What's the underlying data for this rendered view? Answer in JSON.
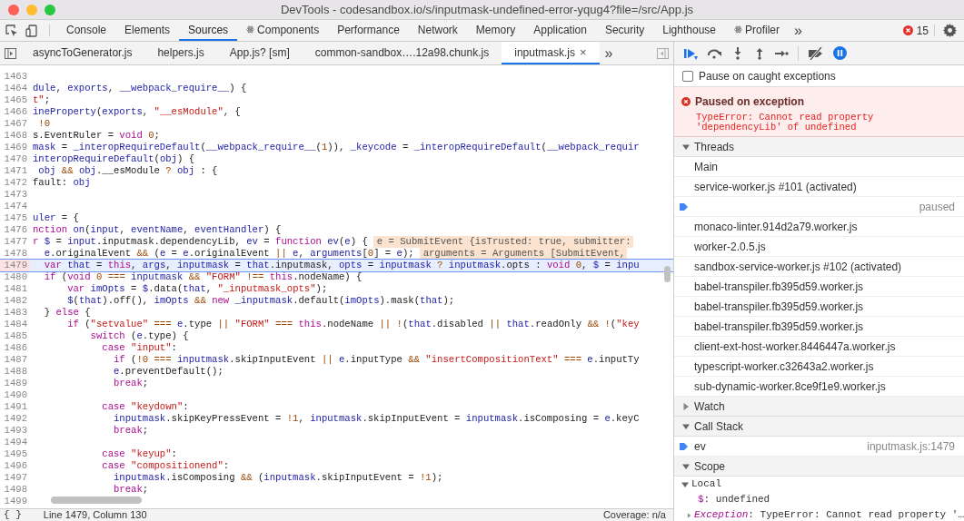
{
  "window": {
    "title": "DevTools - codesandbox.io/s/inputmask-undefined-error-yqug4?file=/src/App.js"
  },
  "panel_tabs": [
    {
      "label": "Console",
      "selected": false,
      "react": false
    },
    {
      "label": "Elements",
      "selected": false,
      "react": false
    },
    {
      "label": "Sources",
      "selected": true,
      "react": false
    },
    {
      "label": "Components",
      "selected": false,
      "react": true
    },
    {
      "label": "Performance",
      "selected": false,
      "react": false
    },
    {
      "label": "Network",
      "selected": false,
      "react": false
    },
    {
      "label": "Memory",
      "selected": false,
      "react": false
    },
    {
      "label": "Application",
      "selected": false,
      "react": false
    },
    {
      "label": "Security",
      "selected": false,
      "react": false
    },
    {
      "label": "Lighthouse",
      "selected": false,
      "react": false
    },
    {
      "label": "Profiler",
      "selected": false,
      "react": true
    }
  ],
  "more_tabs": "»",
  "error_count": "15",
  "file_tabs": [
    {
      "label": "asyncToGenerator.js",
      "selected": false
    },
    {
      "label": "helpers.js",
      "selected": false
    },
    {
      "label": "App.js? [sm]",
      "selected": false
    },
    {
      "label": "common-sandbox….12a98.chunk.js",
      "selected": false
    },
    {
      "label": "inputmask.js",
      "selected": true,
      "close": "×"
    }
  ],
  "more_files": "»",
  "editor": {
    "lines": [
      {
        "number": "1463"
      },
      {
        "number": "1464",
        "tokens": [
          {
            "kind": "name",
            "text": "dule"
          },
          {
            "kind": "plain",
            "text": ", "
          },
          {
            "kind": "name",
            "text": "exports"
          },
          {
            "kind": "plain",
            "text": ", "
          },
          {
            "kind": "name",
            "text": "__webpack_require__"
          },
          {
            "kind": "plain",
            "text": ") {"
          }
        ]
      },
      {
        "number": "1465",
        "tokens": [
          {
            "kind": "string",
            "text": "t\""
          },
          {
            "kind": "plain",
            "text": ";"
          }
        ]
      },
      {
        "number": "1466",
        "tokens": [
          {
            "kind": "name",
            "text": "ineProperty"
          },
          {
            "kind": "plain",
            "text": "("
          },
          {
            "kind": "name",
            "text": "exports"
          },
          {
            "kind": "plain",
            "text": ", "
          },
          {
            "kind": "string",
            "text": "\"__esModule\""
          },
          {
            "kind": "plain",
            "text": ", {"
          }
        ]
      },
      {
        "number": "1467",
        "tokens": [
          {
            "kind": "operator",
            "text": " !0"
          }
        ]
      },
      {
        "number": "1468",
        "tokens": [
          {
            "kind": "plain",
            "text": "s.EventRuler = "
          },
          {
            "kind": "keyword",
            "text": "void "
          },
          {
            "kind": "operator",
            "text": "0"
          },
          {
            "kind": "plain",
            "text": ";"
          }
        ]
      },
      {
        "number": "1469",
        "tokens": [
          {
            "kind": "name",
            "text": "mask"
          },
          {
            "kind": "plain",
            "text": " = "
          },
          {
            "kind": "name",
            "text": "_interopRequireDefault"
          },
          {
            "kind": "plain",
            "text": "("
          },
          {
            "kind": "name",
            "text": "__webpack_require__"
          },
          {
            "kind": "plain",
            "text": "("
          },
          {
            "kind": "operator",
            "text": "1"
          },
          {
            "kind": "plain",
            "text": ")), "
          },
          {
            "kind": "name",
            "text": "_keycode"
          },
          {
            "kind": "plain",
            "text": " = "
          },
          {
            "kind": "name",
            "text": "_interopRequireDefault"
          },
          {
            "kind": "plain",
            "text": "("
          },
          {
            "kind": "name",
            "text": "__webpack_requir"
          }
        ]
      },
      {
        "number": "1470",
        "tokens": [
          {
            "kind": "name",
            "text": "interopRequireDefault"
          },
          {
            "kind": "plain",
            "text": "("
          },
          {
            "kind": "name",
            "text": "obj"
          },
          {
            "kind": "plain",
            "text": ") {"
          }
        ]
      },
      {
        "number": "1471",
        "tokens": [
          {
            "kind": "name",
            "text": " obj "
          },
          {
            "kind": "operator",
            "text": "&& "
          },
          {
            "kind": "name",
            "text": "obj"
          },
          {
            "kind": "plain",
            "text": ".__esModule "
          },
          {
            "kind": "operator",
            "text": "? "
          },
          {
            "kind": "name",
            "text": "obj"
          },
          {
            "kind": "plain",
            "text": " : {"
          }
        ]
      },
      {
        "number": "1472",
        "tokens": [
          {
            "kind": "plain",
            "text": "fault: "
          },
          {
            "kind": "name",
            "text": "obj"
          }
        ]
      },
      {
        "number": "1473"
      },
      {
        "number": "1474"
      },
      {
        "number": "1475",
        "tokens": [
          {
            "kind": "name",
            "text": "uler"
          },
          {
            "kind": "plain",
            "text": " = {"
          }
        ]
      },
      {
        "number": "1476",
        "tokens": [
          {
            "kind": "keyword",
            "text": "nction "
          },
          {
            "kind": "name",
            "text": "on"
          },
          {
            "kind": "plain",
            "text": "("
          },
          {
            "kind": "name",
            "text": "input"
          },
          {
            "kind": "plain",
            "text": ", "
          },
          {
            "kind": "name",
            "text": "eventName"
          },
          {
            "kind": "plain",
            "text": ", "
          },
          {
            "kind": "name",
            "text": "eventHandler"
          },
          {
            "kind": "plain",
            "text": ") {"
          }
        ]
      },
      {
        "number": "1477",
        "tokens": [
          {
            "kind": "keyword",
            "text": "r "
          },
          {
            "kind": "name",
            "text": "$"
          },
          {
            "kind": "plain",
            "text": " = "
          },
          {
            "kind": "name",
            "text": "input"
          },
          {
            "kind": "plain",
            "text": ".inputmask.dependencyLib, "
          },
          {
            "kind": "name",
            "text": "ev"
          },
          {
            "kind": "plain",
            "text": " = "
          },
          {
            "kind": "keyword",
            "text": "function "
          },
          {
            "kind": "name",
            "text": "ev"
          },
          {
            "kind": "plain",
            "text": "("
          },
          {
            "kind": "name",
            "text": "e"
          },
          {
            "kind": "plain",
            "text": ") {"
          }
        ],
        "inline_value": "e = SubmitEvent {isTrusted: true, submitter:"
      },
      {
        "number": "1478",
        "tokens": [
          {
            "kind": "name",
            "text": "  e"
          },
          {
            "kind": "plain",
            "text": ".originalEvent "
          },
          {
            "kind": "operator",
            "text": "&&"
          },
          {
            "kind": "plain",
            "text": " ("
          },
          {
            "kind": "name",
            "text": "e"
          },
          {
            "kind": "plain",
            "text": " = "
          },
          {
            "kind": "name",
            "text": "e"
          },
          {
            "kind": "plain",
            "text": ".originalEvent "
          },
          {
            "kind": "operator",
            "text": "||"
          },
          {
            "kind": "name",
            "text": " e"
          },
          {
            "kind": "plain",
            "text": ", "
          },
          {
            "kind": "name",
            "text": "arguments"
          },
          {
            "kind": "plain",
            "text": "["
          },
          {
            "kind": "operator",
            "text": "0"
          },
          {
            "kind": "plain",
            "text": "] = "
          },
          {
            "kind": "name",
            "text": "e"
          },
          {
            "kind": "plain",
            "text": ");"
          }
        ],
        "inline_value": "arguments = Arguments [SubmitEvent,"
      },
      {
        "number": "1479",
        "current": true,
        "tokens": [
          {
            "kind": "keyword",
            "text": "  var "
          },
          {
            "kind": "name",
            "text": "that"
          },
          {
            "kind": "plain",
            "text": " = "
          },
          {
            "kind": "keyword",
            "text": "this"
          },
          {
            "kind": "plain",
            "text": ", "
          },
          {
            "kind": "name",
            "text": "args"
          },
          {
            "kind": "plain",
            "text": ", "
          },
          {
            "kind": "name",
            "text": "inputmask"
          },
          {
            "kind": "plain",
            "text": " = "
          },
          {
            "kind": "name",
            "text": "that"
          },
          {
            "kind": "plain",
            "text": ".inputmask, "
          },
          {
            "kind": "name",
            "text": "opts"
          },
          {
            "kind": "plain",
            "text": " = "
          },
          {
            "kind": "name",
            "text": "inputmask "
          },
          {
            "kind": "operator",
            "text": "? "
          },
          {
            "kind": "name",
            "text": "inputmask"
          },
          {
            "kind": "plain",
            "text": ".opts : "
          },
          {
            "kind": "keyword",
            "text": "void "
          },
          {
            "kind": "operator",
            "text": "0"
          },
          {
            "kind": "plain",
            "text": ", "
          },
          {
            "kind": "name",
            "text": "$"
          },
          {
            "kind": "plain",
            "text": " = "
          },
          {
            "kind": "name",
            "text": "inpu"
          }
        ]
      },
      {
        "number": "1480",
        "tokens": [
          {
            "kind": "keyword",
            "text": "  if"
          },
          {
            "kind": "plain",
            "text": " ("
          },
          {
            "kind": "keyword",
            "text": "void "
          },
          {
            "kind": "operator",
            "text": "0 === "
          },
          {
            "kind": "name",
            "text": "inputmask "
          },
          {
            "kind": "operator",
            "text": "&& "
          },
          {
            "kind": "string",
            "text": "\"FORM\" "
          },
          {
            "kind": "operator",
            "text": "!== "
          },
          {
            "kind": "keyword",
            "text": "this"
          },
          {
            "kind": "plain",
            "text": ".nodeName) {"
          }
        ]
      },
      {
        "number": "1481",
        "tokens": [
          {
            "kind": "keyword",
            "text": "      var "
          },
          {
            "kind": "name",
            "text": "imOpts"
          },
          {
            "kind": "plain",
            "text": " = "
          },
          {
            "kind": "name",
            "text": "$"
          },
          {
            "kind": "plain",
            "text": ".data("
          },
          {
            "kind": "name",
            "text": "that"
          },
          {
            "kind": "plain",
            "text": ", "
          },
          {
            "kind": "string",
            "text": "\"_inputmask_opts\""
          },
          {
            "kind": "plain",
            "text": ");"
          }
        ]
      },
      {
        "number": "1482",
        "tokens": [
          {
            "kind": "name",
            "text": "      $"
          },
          {
            "kind": "plain",
            "text": "("
          },
          {
            "kind": "name",
            "text": "that"
          },
          {
            "kind": "plain",
            "text": ").off(), "
          },
          {
            "kind": "name",
            "text": "imOpts "
          },
          {
            "kind": "operator",
            "text": "&& "
          },
          {
            "kind": "keyword",
            "text": "new "
          },
          {
            "kind": "name",
            "text": "_inputmask"
          },
          {
            "kind": "plain",
            "text": ".default("
          },
          {
            "kind": "name",
            "text": "imOpts"
          },
          {
            "kind": "plain",
            "text": ").mask("
          },
          {
            "kind": "name",
            "text": "that"
          },
          {
            "kind": "plain",
            "text": ");"
          }
        ]
      },
      {
        "number": "1483",
        "tokens": [
          {
            "kind": "plain",
            "text": "  } "
          },
          {
            "kind": "keyword",
            "text": "else"
          },
          {
            "kind": "plain",
            "text": " {"
          }
        ]
      },
      {
        "number": "1484",
        "tokens": [
          {
            "kind": "keyword",
            "text": "      if"
          },
          {
            "kind": "plain",
            "text": " ("
          },
          {
            "kind": "string",
            "text": "\"setvalue\" "
          },
          {
            "kind": "operator",
            "text": "=== "
          },
          {
            "kind": "name",
            "text": "e"
          },
          {
            "kind": "plain",
            "text": ".type "
          },
          {
            "kind": "operator",
            "text": "|| "
          },
          {
            "kind": "string",
            "text": "\"FORM\" "
          },
          {
            "kind": "operator",
            "text": "=== "
          },
          {
            "kind": "keyword",
            "text": "this"
          },
          {
            "kind": "plain",
            "text": ".nodeName "
          },
          {
            "kind": "operator",
            "text": "|| !"
          },
          {
            "kind": "plain",
            "text": "("
          },
          {
            "kind": "name",
            "text": "that"
          },
          {
            "kind": "plain",
            "text": ".disabled "
          },
          {
            "kind": "operator",
            "text": "|| "
          },
          {
            "kind": "name",
            "text": "that"
          },
          {
            "kind": "plain",
            "text": ".readOnly "
          },
          {
            "kind": "operator",
            "text": "&& !"
          },
          {
            "kind": "plain",
            "text": "("
          },
          {
            "kind": "string",
            "text": "\"key"
          }
        ]
      },
      {
        "number": "1485",
        "tokens": [
          {
            "kind": "keyword",
            "text": "          switch"
          },
          {
            "kind": "plain",
            "text": " ("
          },
          {
            "kind": "name",
            "text": "e"
          },
          {
            "kind": "plain",
            "text": ".type) {"
          }
        ]
      },
      {
        "number": "1486",
        "tokens": [
          {
            "kind": "keyword",
            "text": "            case "
          },
          {
            "kind": "string",
            "text": "\"input\""
          },
          {
            "kind": "plain",
            "text": ":"
          }
        ]
      },
      {
        "number": "1487",
        "tokens": [
          {
            "kind": "keyword",
            "text": "              if"
          },
          {
            "kind": "plain",
            "text": " ("
          },
          {
            "kind": "operator",
            "text": "!0 === "
          },
          {
            "kind": "name",
            "text": "inputmask"
          },
          {
            "kind": "plain",
            "text": ".skipInputEvent "
          },
          {
            "kind": "operator",
            "text": "|| "
          },
          {
            "kind": "name",
            "text": "e"
          },
          {
            "kind": "plain",
            "text": ".inputType "
          },
          {
            "kind": "operator",
            "text": "&& "
          },
          {
            "kind": "string",
            "text": "\"insertCompositionText\" "
          },
          {
            "kind": "operator",
            "text": "=== "
          },
          {
            "kind": "name",
            "text": "e"
          },
          {
            "kind": "plain",
            "text": ".inputTy"
          }
        ]
      },
      {
        "number": "1488",
        "tokens": [
          {
            "kind": "name",
            "text": "              e"
          },
          {
            "kind": "plain",
            "text": ".preventDefault();"
          }
        ]
      },
      {
        "number": "1489",
        "tokens": [
          {
            "kind": "keyword",
            "text": "              break"
          },
          {
            "kind": "plain",
            "text": ";"
          }
        ]
      },
      {
        "number": "1490"
      },
      {
        "number": "1491",
        "tokens": [
          {
            "kind": "keyword",
            "text": "            case "
          },
          {
            "kind": "string",
            "text": "\"keydown\""
          },
          {
            "kind": "plain",
            "text": ":"
          }
        ]
      },
      {
        "number": "1492",
        "tokens": [
          {
            "kind": "name",
            "text": "              inputmask"
          },
          {
            "kind": "plain",
            "text": ".skipKeyPressEvent = "
          },
          {
            "kind": "operator",
            "text": "!1"
          },
          {
            "kind": "plain",
            "text": ", "
          },
          {
            "kind": "name",
            "text": "inputmask"
          },
          {
            "kind": "plain",
            "text": ".skipInputEvent = "
          },
          {
            "kind": "name",
            "text": "inputmask"
          },
          {
            "kind": "plain",
            "text": ".isComposing = "
          },
          {
            "kind": "name",
            "text": "e"
          },
          {
            "kind": "plain",
            "text": ".keyC"
          }
        ]
      },
      {
        "number": "1493",
        "tokens": [
          {
            "kind": "keyword",
            "text": "              break"
          },
          {
            "kind": "plain",
            "text": ";"
          }
        ]
      },
      {
        "number": "1494"
      },
      {
        "number": "1495",
        "tokens": [
          {
            "kind": "keyword",
            "text": "            case "
          },
          {
            "kind": "string",
            "text": "\"keyup\""
          },
          {
            "kind": "plain",
            "text": ":"
          }
        ]
      },
      {
        "number": "1496",
        "tokens": [
          {
            "kind": "keyword",
            "text": "            case "
          },
          {
            "kind": "string",
            "text": "\"compositionend\""
          },
          {
            "kind": "plain",
            "text": ":"
          }
        ]
      },
      {
        "number": "1497",
        "tokens": [
          {
            "kind": "name",
            "text": "              inputmask"
          },
          {
            "kind": "plain",
            "text": ".isComposing "
          },
          {
            "kind": "operator",
            "text": "&&"
          },
          {
            "kind": "plain",
            "text": " ("
          },
          {
            "kind": "name",
            "text": "inputmask"
          },
          {
            "kind": "plain",
            "text": ".skipInputEvent = "
          },
          {
            "kind": "operator",
            "text": "!1"
          },
          {
            "kind": "plain",
            "text": ");"
          }
        ]
      },
      {
        "number": "1498",
        "tokens": [
          {
            "kind": "keyword",
            "text": "              break"
          },
          {
            "kind": "plain",
            "text": ";"
          }
        ]
      },
      {
        "number": "1499"
      }
    ]
  },
  "status_bar": {
    "braces": "{ }",
    "position": "Line 1479, Column 130",
    "coverage": "Coverage: n/a"
  },
  "debugger": {
    "pause_on_caught": {
      "label": "Pause on caught exceptions",
      "checked": false
    },
    "exception": {
      "title": "Paused on exception",
      "message": "TypeError: Cannot read property 'dependencyLib' of undefined"
    },
    "sections": [
      {
        "kind": "threads",
        "title": "Threads",
        "expanded": true,
        "items": [
          {
            "name": "Main",
            "current": false
          },
          {
            "name": "service-worker.js #101 (activated)",
            "current": false
          },
          {
            "status": "paused",
            "current": true
          },
          {
            "name": "monaco-linter.914d2a79.worker.js",
            "current": false
          },
          {
            "name": "worker-2.0.5.js",
            "current": false
          },
          {
            "name": "sandbox-service-worker.js #102 (activated)",
            "current": false
          },
          {
            "name": "babel-transpiler.fb395d59.worker.js",
            "current": false
          },
          {
            "name": "babel-transpiler.fb395d59.worker.js",
            "current": false
          },
          {
            "name": "babel-transpiler.fb395d59.worker.js",
            "current": false
          },
          {
            "name": "client-ext-host-worker.8446447a.worker.js",
            "current": false
          },
          {
            "name": "typescript-worker.c32643a2.worker.js",
            "current": false
          },
          {
            "name": "sub-dynamic-worker.8ce9f1e9.worker.js",
            "current": false
          }
        ]
      },
      {
        "kind": "watch",
        "title": "Watch",
        "expanded": false
      },
      {
        "kind": "callstack",
        "title": "Call Stack",
        "expanded": true,
        "items": [
          {
            "name": "ev",
            "location": "inputmask.js:1479",
            "current": true
          }
        ]
      },
      {
        "kind": "scope",
        "title": "Scope",
        "expanded": true,
        "groups": [
          {
            "title": "Local",
            "expanded": true,
            "vars": [
              {
                "name": "$",
                "value": ": undefined",
                "expandable": false,
                "italic": false
              },
              {
                "name": "Exception",
                "value": ": TypeError: Cannot read property '…",
                "expandable": true,
                "italic": true
              }
            ]
          }
        ]
      }
    ]
  }
}
